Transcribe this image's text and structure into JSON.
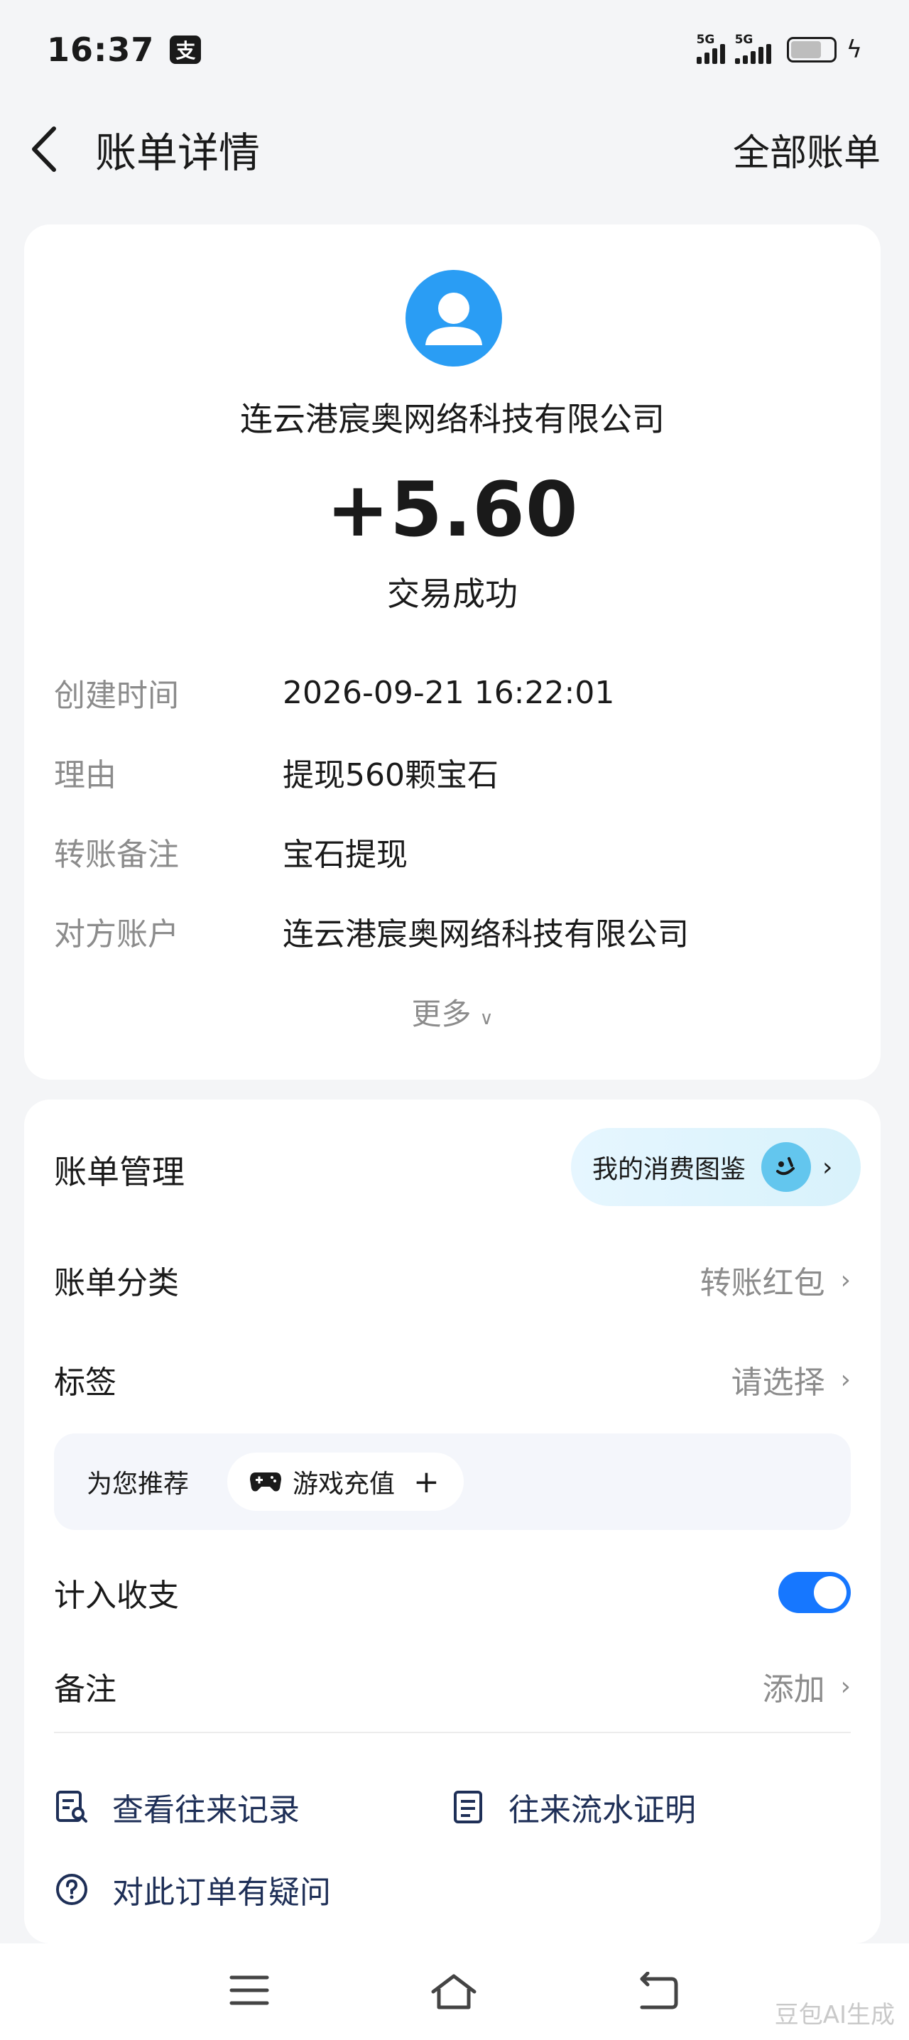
{
  "status_bar": {
    "time": "16:37",
    "app_badge": "支",
    "signal_1": "5G",
    "signal_2": "5G"
  },
  "header": {
    "title": "账单详情",
    "all_bills": "全部账单"
  },
  "transaction": {
    "counterparty": "连云港宸奥网络科技有限公司",
    "amount": "+5.60",
    "status": "交易成功",
    "details": [
      {
        "label": "创建时间",
        "value": "2026-09-21 16:22:01"
      },
      {
        "label": "理由",
        "value": "提现560颗宝石"
      },
      {
        "label": "转账备注",
        "value": "宝石提现"
      },
      {
        "label": "对方账户",
        "value": "连云港宸奥网络科技有限公司"
      }
    ],
    "more": "更多"
  },
  "management": {
    "title": "账单管理",
    "spending_pill": "我的消费图鉴",
    "category_label": "账单分类",
    "category_value": "转账红包",
    "tag_label": "标签",
    "tag_value": "请选择",
    "recommend_label": "为您推荐",
    "recommend_chip": "游戏充值",
    "recommend_plus": "+",
    "count_label": "计入收支",
    "count_enabled": true,
    "note_label": "备注",
    "note_value": "添加"
  },
  "links": {
    "history": "查看往来记录",
    "statement": "往来流水证明",
    "question": "对此订单有疑问"
  },
  "watermark": "豆包AI生成",
  "colors": {
    "accent": "#1677ff",
    "avatar": "#2a9df4",
    "link_text": "#1e2f57",
    "secondary_text": "#8c8c8c"
  }
}
